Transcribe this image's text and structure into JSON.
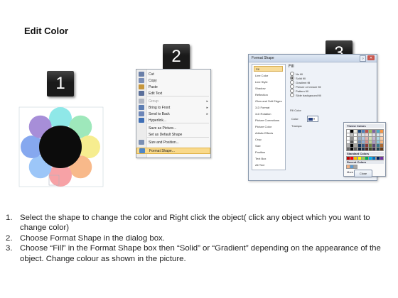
{
  "title": "Edit Color",
  "badges": [
    "1",
    "2",
    "3"
  ],
  "colors": {
    "badge": "#1a1a1a",
    "petals": [
      "#8fe8e8",
      "#9ee8bb",
      "#f6ed8f",
      "#f8b98a",
      "#f7a2a6",
      "#9cc6f8",
      "#86a8ef",
      "#a78ed8"
    ],
    "center": "#0c0c0c",
    "menu_highlight": "#f9d98a"
  },
  "context_menu": {
    "items": [
      {
        "label": "Cut",
        "icon": "scissors-icon"
      },
      {
        "label": "Copy",
        "icon": "copy-icon"
      },
      {
        "label": "Paste",
        "icon": "paste-icon"
      },
      {
        "label": "Edit Text",
        "icon": "edit-text-icon"
      },
      {
        "label": "Group",
        "icon": "group-icon",
        "submenu": true
      },
      {
        "label": "Bring to Front",
        "icon": "bring-front-icon",
        "submenu": true
      },
      {
        "label": "Send to Back",
        "icon": "send-back-icon",
        "submenu": true
      },
      {
        "label": "Hyperlink...",
        "icon": "hyperlink-icon"
      },
      {
        "label": "Save as Picture...",
        "icon": ""
      },
      {
        "label": "Set as Default Shape",
        "icon": ""
      },
      {
        "label": "Size and Position...",
        "icon": "size-icon"
      },
      {
        "label": "Format Shape...",
        "icon": "format-shape-icon"
      }
    ]
  },
  "format_dialog": {
    "title": "Format Shape",
    "close_label": "Close",
    "nav": [
      "Fill",
      "Line Color",
      "Line Style",
      "Shadow",
      "Reflection",
      "Glow and Soft Edges",
      "3-D Format",
      "3-D Rotation",
      "Picture Corrections",
      "Picture Color",
      "Artistic Effects",
      "Crop",
      "Size",
      "Position",
      "Text Box",
      "Alt Text"
    ],
    "pane_title": "Fill",
    "fill_options": [
      "No fill",
      "Solid fill",
      "Gradient fill",
      "Picture or texture fill",
      "Pattern fill",
      "Slide background fill"
    ],
    "fill_color_label": "Fill Color",
    "color_label": "Color:",
    "transparency_label": "Transpa",
    "theme_colors_label": "Theme Colors",
    "standard_colors_label": "Standard Colors",
    "recent_colors_label": "Recent Colors",
    "more_colors_label": "More Colors..."
  },
  "steps": [
    {
      "num": "1.",
      "text": "Select the shape to change the color and Right click the object( click any object which you want to change color)"
    },
    {
      "num": "2.",
      "text": "Choose Format Shape in the dialog box."
    },
    {
      "num": "3.",
      "text": "Choose “Fill” in the Format Shape box then “Solid” or “Gradient” depending on the appearance of the object. Change colour as shown in the picture."
    }
  ]
}
